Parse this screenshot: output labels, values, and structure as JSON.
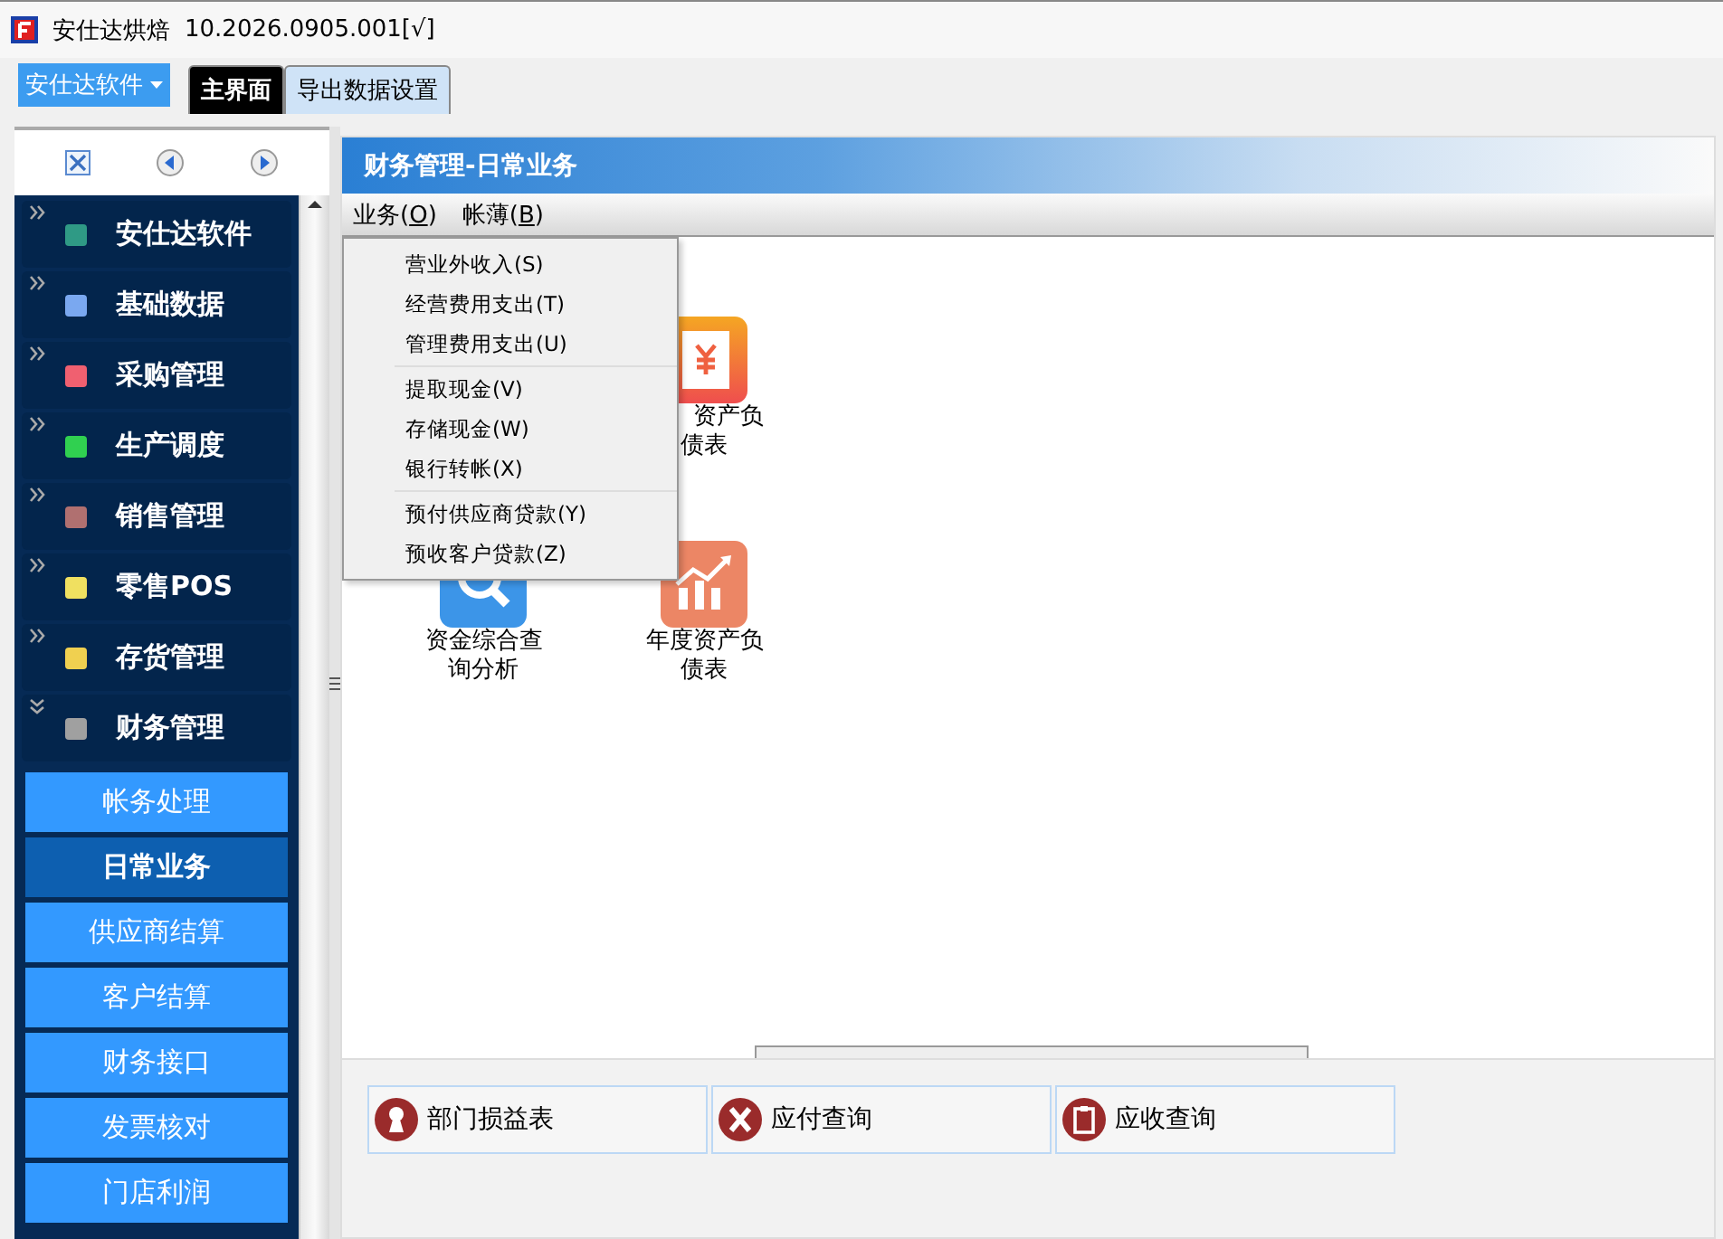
{
  "app": {
    "title": "安仕达烘焙",
    "version": "10.2026.0905.001[√]"
  },
  "toolbar": {
    "menu_button": "安仕达软件",
    "tabs": [
      {
        "label": "主界面",
        "selected": true
      },
      {
        "label": "导出数据设置",
        "selected": false
      }
    ]
  },
  "sidebar": {
    "groups": [
      {
        "label": "安仕达软件",
        "color": "#2f9a85",
        "expanded": false
      },
      {
        "label": "基础数据",
        "color": "#7aa8f0",
        "expanded": false
      },
      {
        "label": "采购管理",
        "color": "#f06070",
        "expanded": false
      },
      {
        "label": "生产调度",
        "color": "#30d050",
        "expanded": false
      },
      {
        "label": "销售管理",
        "color": "#b07070",
        "expanded": false
      },
      {
        "label": "零售POS",
        "color": "#f0e060",
        "expanded": false
      },
      {
        "label": "存货管理",
        "color": "#f0d050",
        "expanded": false
      },
      {
        "label": "财务管理",
        "color": "#a0a0a0",
        "expanded": true,
        "children": [
          {
            "label": "帐务处理",
            "selected": false
          },
          {
            "label": "日常业务",
            "selected": true
          },
          {
            "label": "供应商结算",
            "selected": false
          },
          {
            "label": "客户结算",
            "selected": false
          },
          {
            "label": "财务接口",
            "selected": false
          },
          {
            "label": "发票核对",
            "selected": false
          },
          {
            "label": "门店利润",
            "selected": false
          }
        ]
      }
    ]
  },
  "panel": {
    "title": "财务管理-日常业务",
    "menus": [
      {
        "prefix": "业务(",
        "key": "O",
        "suffix": ")"
      },
      {
        "prefix": "帐薄(",
        "key": "B",
        "suffix": ")"
      }
    ],
    "dropdown": [
      [
        "营业外收入(S)",
        "经营费用支出(T)",
        "管理费用支出(U)"
      ],
      [
        "提取现金(V)",
        "存储现金(W)",
        "银行转帐(X)"
      ],
      [
        "预付供应商贷款(Y)",
        "预收客户贷款(Z)"
      ]
    ],
    "tiles": [
      {
        "lines": [
          "资产负",
          "债表"
        ],
        "kind": "ledger"
      },
      {
        "lines": [
          "资金综合查",
          "询分析"
        ],
        "kind": "search"
      },
      {
        "lines": [
          "年度资产负",
          "债表"
        ],
        "kind": "chart"
      }
    ],
    "buttons": [
      {
        "label": "部门损益表",
        "kind": "person"
      },
      {
        "label": "应付查询",
        "kind": "cross"
      },
      {
        "label": "应收查询",
        "kind": "clipboard"
      }
    ]
  }
}
